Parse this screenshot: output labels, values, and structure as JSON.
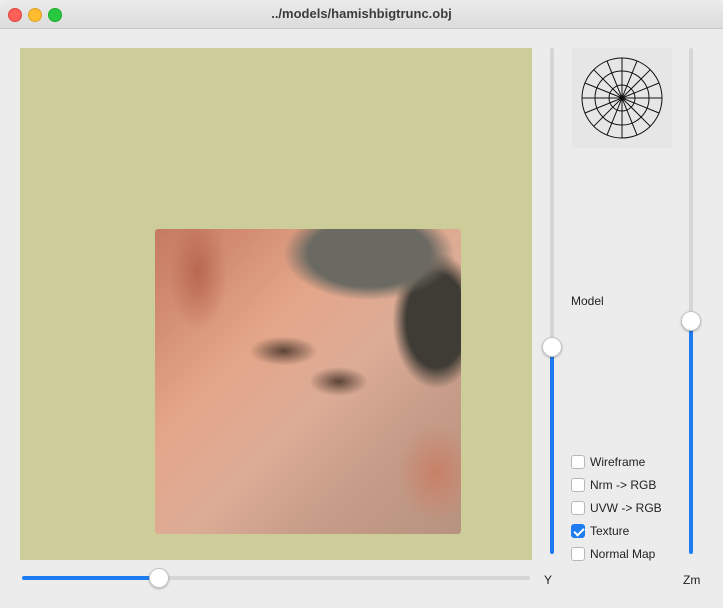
{
  "window": {
    "title": "../models/hamishbigtrunc.obj"
  },
  "viewport": {
    "background_color": "#cdcd9a",
    "content": "textured-face-render"
  },
  "sliders": {
    "horizontal": {
      "value": 0.27
    },
    "y": {
      "label": "Y",
      "value": 0.41
    },
    "zm": {
      "label": "Zm",
      "value": 0.46
    }
  },
  "gizmo": {
    "icon": "rotation-sphere-icon"
  },
  "panel": {
    "model_label": "Model",
    "options": [
      {
        "label": "Wireframe",
        "checked": false
      },
      {
        "label": "Nrm -> RGB",
        "checked": false
      },
      {
        "label": "UVW -> RGB",
        "checked": false
      },
      {
        "label": "Texture",
        "checked": true
      },
      {
        "label": "Normal Map",
        "checked": false
      }
    ]
  },
  "colors": {
    "accent": "#1f7cf0",
    "close": "#fe5f57",
    "minimize": "#febc2e",
    "maximize": "#28c840"
  }
}
